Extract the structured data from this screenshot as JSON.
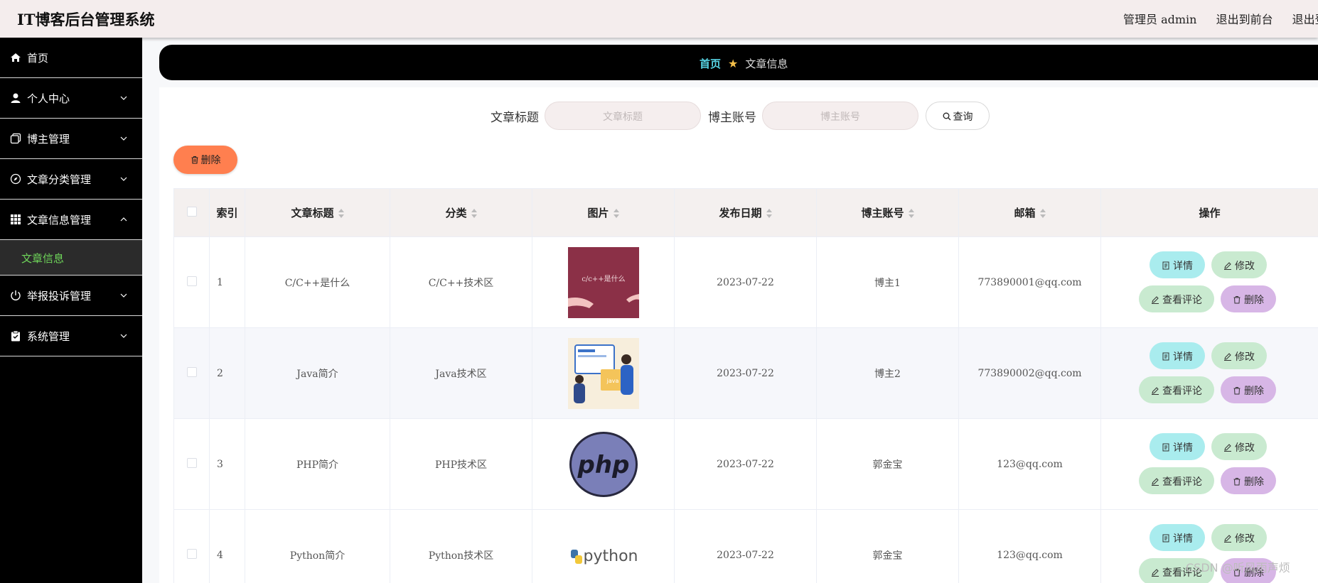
{
  "header": {
    "app_title": "IT博客后台管理系统",
    "admin_label": "管理员 admin",
    "to_front": "退出到前台",
    "logout": "退出登录"
  },
  "sidebar": {
    "items": [
      {
        "label": "首页",
        "icon": "home-icon"
      },
      {
        "label": "个人中心",
        "icon": "user-icon"
      },
      {
        "label": "博主管理",
        "icon": "copy-icon"
      },
      {
        "label": "文章分类管理",
        "icon": "compass-icon"
      },
      {
        "label": "文章信息管理",
        "icon": "grid-icon"
      },
      {
        "label": "举报投诉管理",
        "icon": "power-icon"
      },
      {
        "label": "系统管理",
        "icon": "clipboard-icon"
      }
    ],
    "active_sub": "文章信息"
  },
  "breadcrumb": {
    "home": "首页",
    "current": "文章信息"
  },
  "search": {
    "title_label": "文章标题",
    "title_placeholder": "文章标题",
    "account_label": "博主账号",
    "account_placeholder": "博主账号",
    "query_button": "查询"
  },
  "toolbar": {
    "delete_label": "删除"
  },
  "table": {
    "headers": {
      "index": "索引",
      "title": "文章标题",
      "category": "分类",
      "image": "图片",
      "date": "发布日期",
      "account": "博主账号",
      "email": "邮箱",
      "ops": "操作"
    },
    "rows": [
      {
        "index": "1",
        "title": "C/C++是什么",
        "category": "C/C++技术区",
        "image": "c/c++是什么",
        "date": "2023-07-22",
        "account": "博主1",
        "email": "773890001@qq.com"
      },
      {
        "index": "2",
        "title": "Java简介",
        "category": "Java技术区",
        "image": "java",
        "date": "2023-07-22",
        "account": "博主2",
        "email": "773890002@qq.com"
      },
      {
        "index": "3",
        "title": "PHP简介",
        "category": "PHP技术区",
        "image": "php",
        "date": "2023-07-22",
        "account": "郭金宝",
        "email": "123@qq.com"
      },
      {
        "index": "4",
        "title": "Python简介",
        "category": "Python技术区",
        "image": "python",
        "date": "2023-07-22",
        "account": "郭金宝",
        "email": "123@qq.com"
      }
    ],
    "ops": {
      "detail": "详情",
      "edit": "修改",
      "comments": "查看评论",
      "delete": "删除"
    }
  },
  "watermark": "CSDN @听风雨声烦",
  "colors": {
    "breadcrumb_home": "#57d3e3",
    "sidebar_active": "#6fd65a",
    "delete_button": "#ff7f4f",
    "op_detail": "#a9ecee",
    "op_edit": "#c9ead0",
    "op_delete": "#d7b6e6"
  }
}
